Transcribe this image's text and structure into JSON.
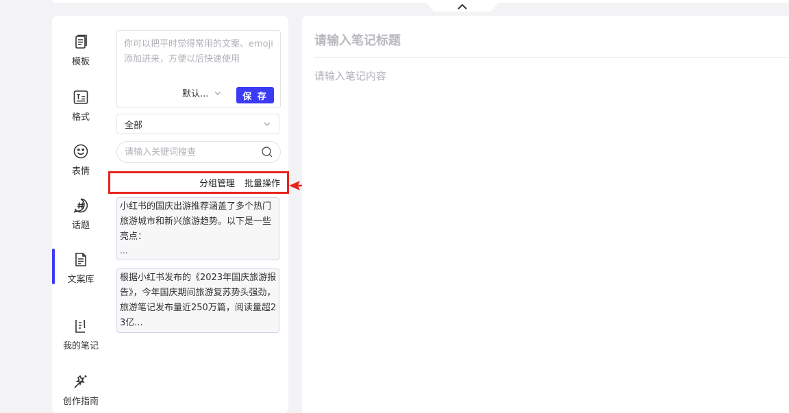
{
  "nav": {
    "items": [
      {
        "label": "模板",
        "icon": "template-icon"
      },
      {
        "label": "格式",
        "icon": "format-icon"
      },
      {
        "label": "表情",
        "icon": "emoji-icon"
      },
      {
        "label": "话题",
        "icon": "topic-icon"
      },
      {
        "label": "文案库",
        "icon": "copy-library-icon",
        "active": true
      },
      {
        "label": "我的笔记",
        "icon": "my-notes-icon"
      },
      {
        "label": "创作指南",
        "icon": "creation-guide-icon"
      }
    ],
    "active_color": "#3b3bf5"
  },
  "copy_library": {
    "editor_placeholder": "你可以把平时觉得常用的文案、emoji添加进来，方便以后快速使用",
    "group_select_value": "默认...",
    "save_label": "保 存",
    "filter_value": "全部",
    "search_placeholder": "请输入关键词搜查",
    "group_manage_label": "分组管理",
    "batch_label": "批量操作",
    "snippets": [
      {
        "text": "小红书的国庆出游推荐涵盖了多个热门旅游城市和新兴旅游趋势。以下是一些亮点：",
        "ellipsis": "..."
      },
      {
        "text": "根据小红书发布的《2023年国庆旅游报告》，今年国庆期间旅游复苏势头强劲，旅游笔记发布量近250万篇，阅读量超23亿...",
        "ellipsis": ""
      }
    ]
  },
  "editor": {
    "title_placeholder": "请输入笔记标题",
    "content_placeholder": "请输入笔记内容"
  },
  "colors": {
    "accent": "#3b3bf5",
    "highlight": "#e8231c"
  }
}
